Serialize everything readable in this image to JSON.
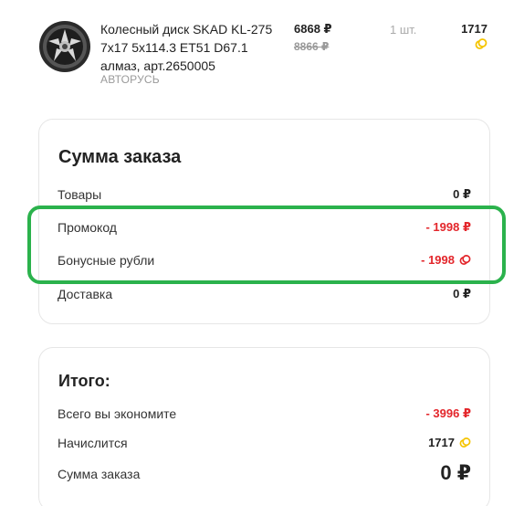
{
  "product": {
    "name": "Колесный диск SKAD KL-275 7x17 5x114.3 ET51 D67.1 алмаз, арт.2650005",
    "seller": "АВТОРУСЬ",
    "price_current": "6868 ₽",
    "price_old": "8866 ₽",
    "quantity": "1 шт.",
    "bonus_points": "1717",
    "bonus_icon": "coin-icon"
  },
  "summary": {
    "title": "Сумма заказа",
    "rows": [
      {
        "label": "Товары",
        "value": "0 ₽"
      },
      {
        "label": "Промокод",
        "value": "- 1998 ₽"
      },
      {
        "label": "Бонусные рубли",
        "value": "- 1998"
      },
      {
        "label": "Доставка",
        "value": "0 ₽"
      }
    ]
  },
  "total": {
    "title": "Итого:",
    "rows": [
      {
        "label": "Всего вы экономите",
        "value": "- 3996 ₽"
      },
      {
        "label": "Начислится",
        "value": "1717"
      },
      {
        "label": "Сумма заказа",
        "value": "0 ₽"
      }
    ]
  },
  "colors": {
    "accent_red": "#e3262b",
    "highlight_green": "#2bb24c",
    "coin_yellow": "#f5c400"
  }
}
